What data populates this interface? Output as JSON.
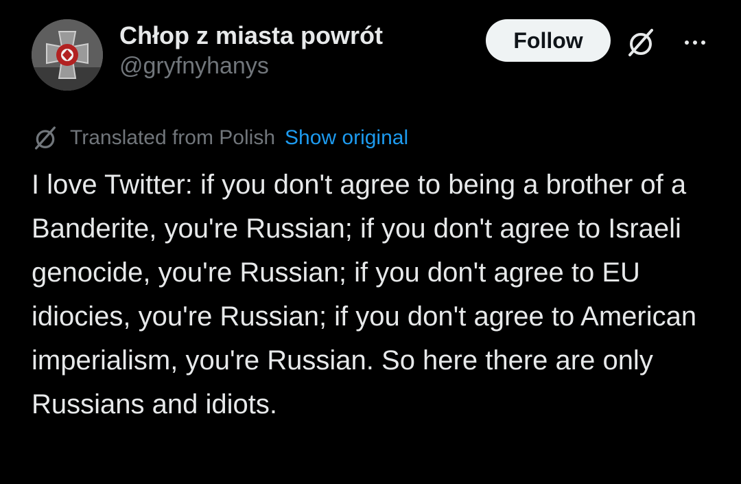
{
  "author": {
    "display_name": "Chłop z miasta powrót",
    "handle": "@gryfnyhanys",
    "avatar_icon": "avatar-cross-emblem"
  },
  "actions": {
    "follow_label": "Follow",
    "grok_icon": "grok-icon",
    "more_icon": "more-dots-icon"
  },
  "translation": {
    "icon": "grok-icon",
    "label": "Translated from Polish",
    "show_original_label": "Show original"
  },
  "tweet": {
    "text": "I love Twitter: if you don't agree to being a brother of a Banderite, you're Russian; if you don't agree to Israeli genocide, you're Russian; if you don't agree to EU idiocies, you're Russian; if you don't agree to American imperialism, you're Russian. So here there are only Russians and idiots."
  },
  "colors": {
    "background": "#000000",
    "text": "#e7e9ea",
    "secondary_text": "#71767b",
    "link": "#1d9bf0",
    "follow_button_bg": "#eff3f4"
  }
}
